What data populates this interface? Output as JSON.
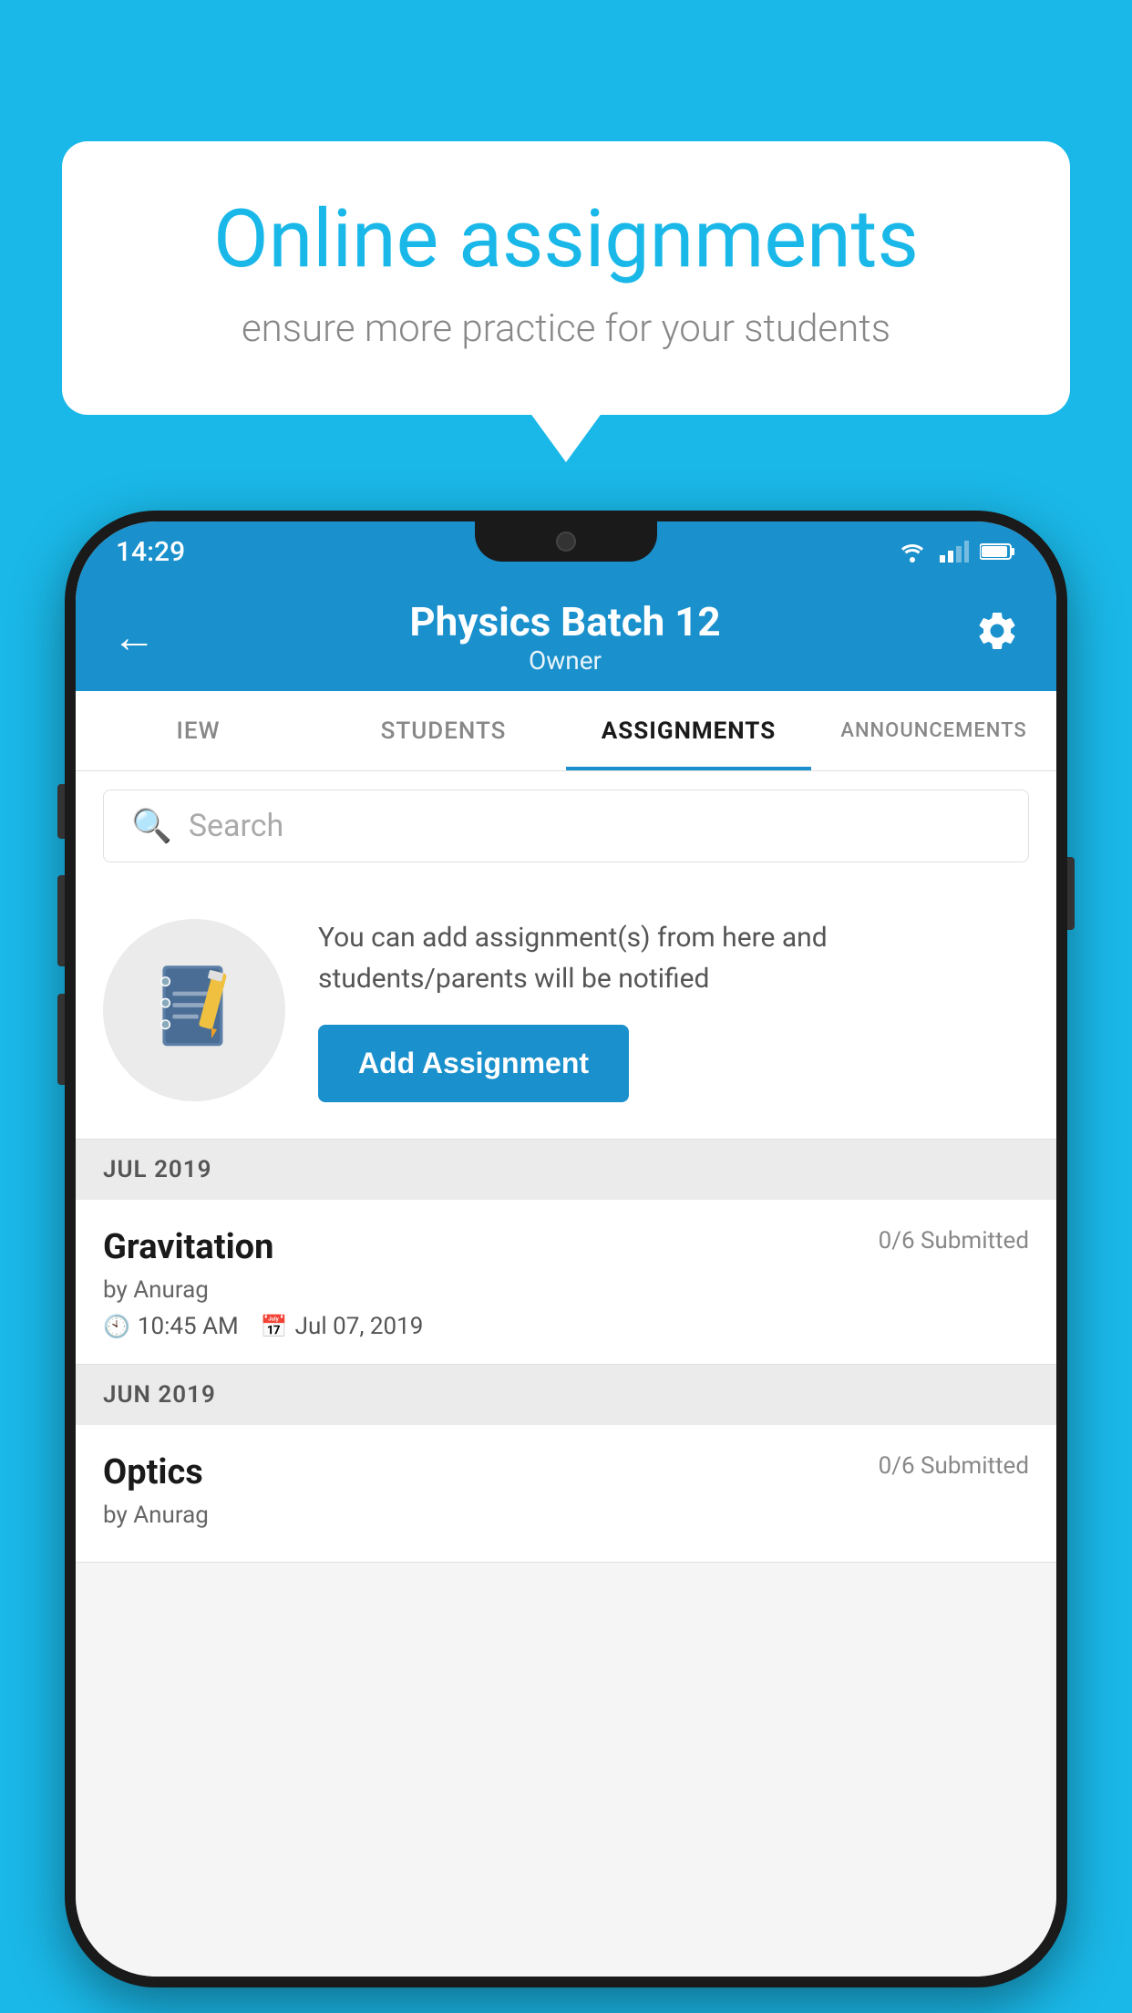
{
  "background": {
    "color": "#1ab8e8"
  },
  "speech_bubble": {
    "title": "Online assignments",
    "subtitle": "ensure more practice for your students"
  },
  "phone": {
    "status_bar": {
      "time": "14:29"
    },
    "app_bar": {
      "title": "Physics Batch 12",
      "subtitle": "Owner",
      "back_label": "←",
      "settings_label": "⚙"
    },
    "tabs": [
      {
        "label": "IEW",
        "active": false
      },
      {
        "label": "STUDENTS",
        "active": false
      },
      {
        "label": "ASSIGNMENTS",
        "active": true
      },
      {
        "label": "ANNOUNCEMENTS",
        "active": false
      }
    ],
    "search": {
      "placeholder": "Search"
    },
    "promo": {
      "description": "You can add assignment(s) from here and students/parents will be notified",
      "button_label": "Add Assignment"
    },
    "sections": [
      {
        "header": "JUL 2019",
        "assignments": [
          {
            "name": "Gravitation",
            "submitted": "0/6 Submitted",
            "by": "by Anurag",
            "time": "10:45 AM",
            "date": "Jul 07, 2019"
          }
        ]
      },
      {
        "header": "JUN 2019",
        "assignments": [
          {
            "name": "Optics",
            "submitted": "0/6 Submitted",
            "by": "by Anurag",
            "time": "",
            "date": ""
          }
        ]
      }
    ]
  }
}
